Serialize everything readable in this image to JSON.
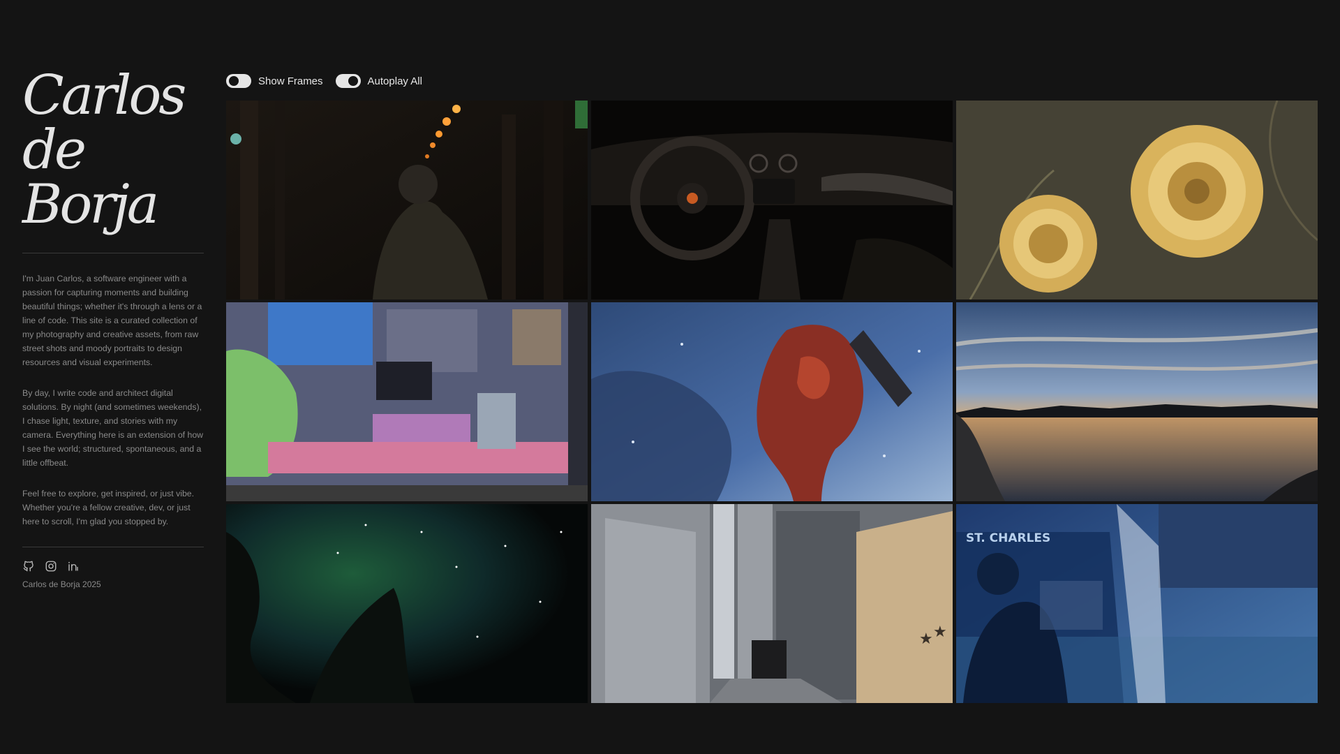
{
  "profile": {
    "name_line1": "Carlos",
    "name_line2": "de Borja",
    "paragraphs": [
      "I'm Juan Carlos, a software engineer with a passion for capturing moments and building beautiful things; whether it's through a lens or a line of code. This site is a curated collection of my photography and creative assets, from raw street shots and moody portraits to design resources and visual experiments.",
      "By day, I write code and architect digital solutions. By night (and sometimes weekends), I chase light, texture, and stories with my camera. Everything here is an extension of how I see the world; structured, spontaneous, and a little offbeat.",
      "Feel free to explore, get inspired, or just vibe. Whether you're a fellow creative, dev, or just here to scroll, I'm glad you stopped by."
    ],
    "socials": [
      "github-icon",
      "instagram-icon",
      "linkedin-icon"
    ],
    "copyright": "Carlos de Borja 2025"
  },
  "controls": {
    "show_frames": {
      "label": "Show Frames",
      "enabled": false
    },
    "autoplay_all": {
      "label": "Autoplay All",
      "enabled": true
    }
  },
  "gallery": {
    "tiles": [
      {
        "id": "night-walk"
      },
      {
        "id": "car-interior"
      },
      {
        "id": "dandelions"
      },
      {
        "id": "3d-room"
      },
      {
        "id": "red-mech"
      },
      {
        "id": "lake-sunset"
      },
      {
        "id": "starry-sky"
      },
      {
        "id": "city-alley"
      },
      {
        "id": "st-charles-bus",
        "sign_text": "ST. CHARLES"
      }
    ]
  },
  "colors": {
    "background": "#141414",
    "text_primary": "#e6e6e6",
    "text_muted": "#8a8a8a",
    "divider": "#3a3a3a"
  }
}
